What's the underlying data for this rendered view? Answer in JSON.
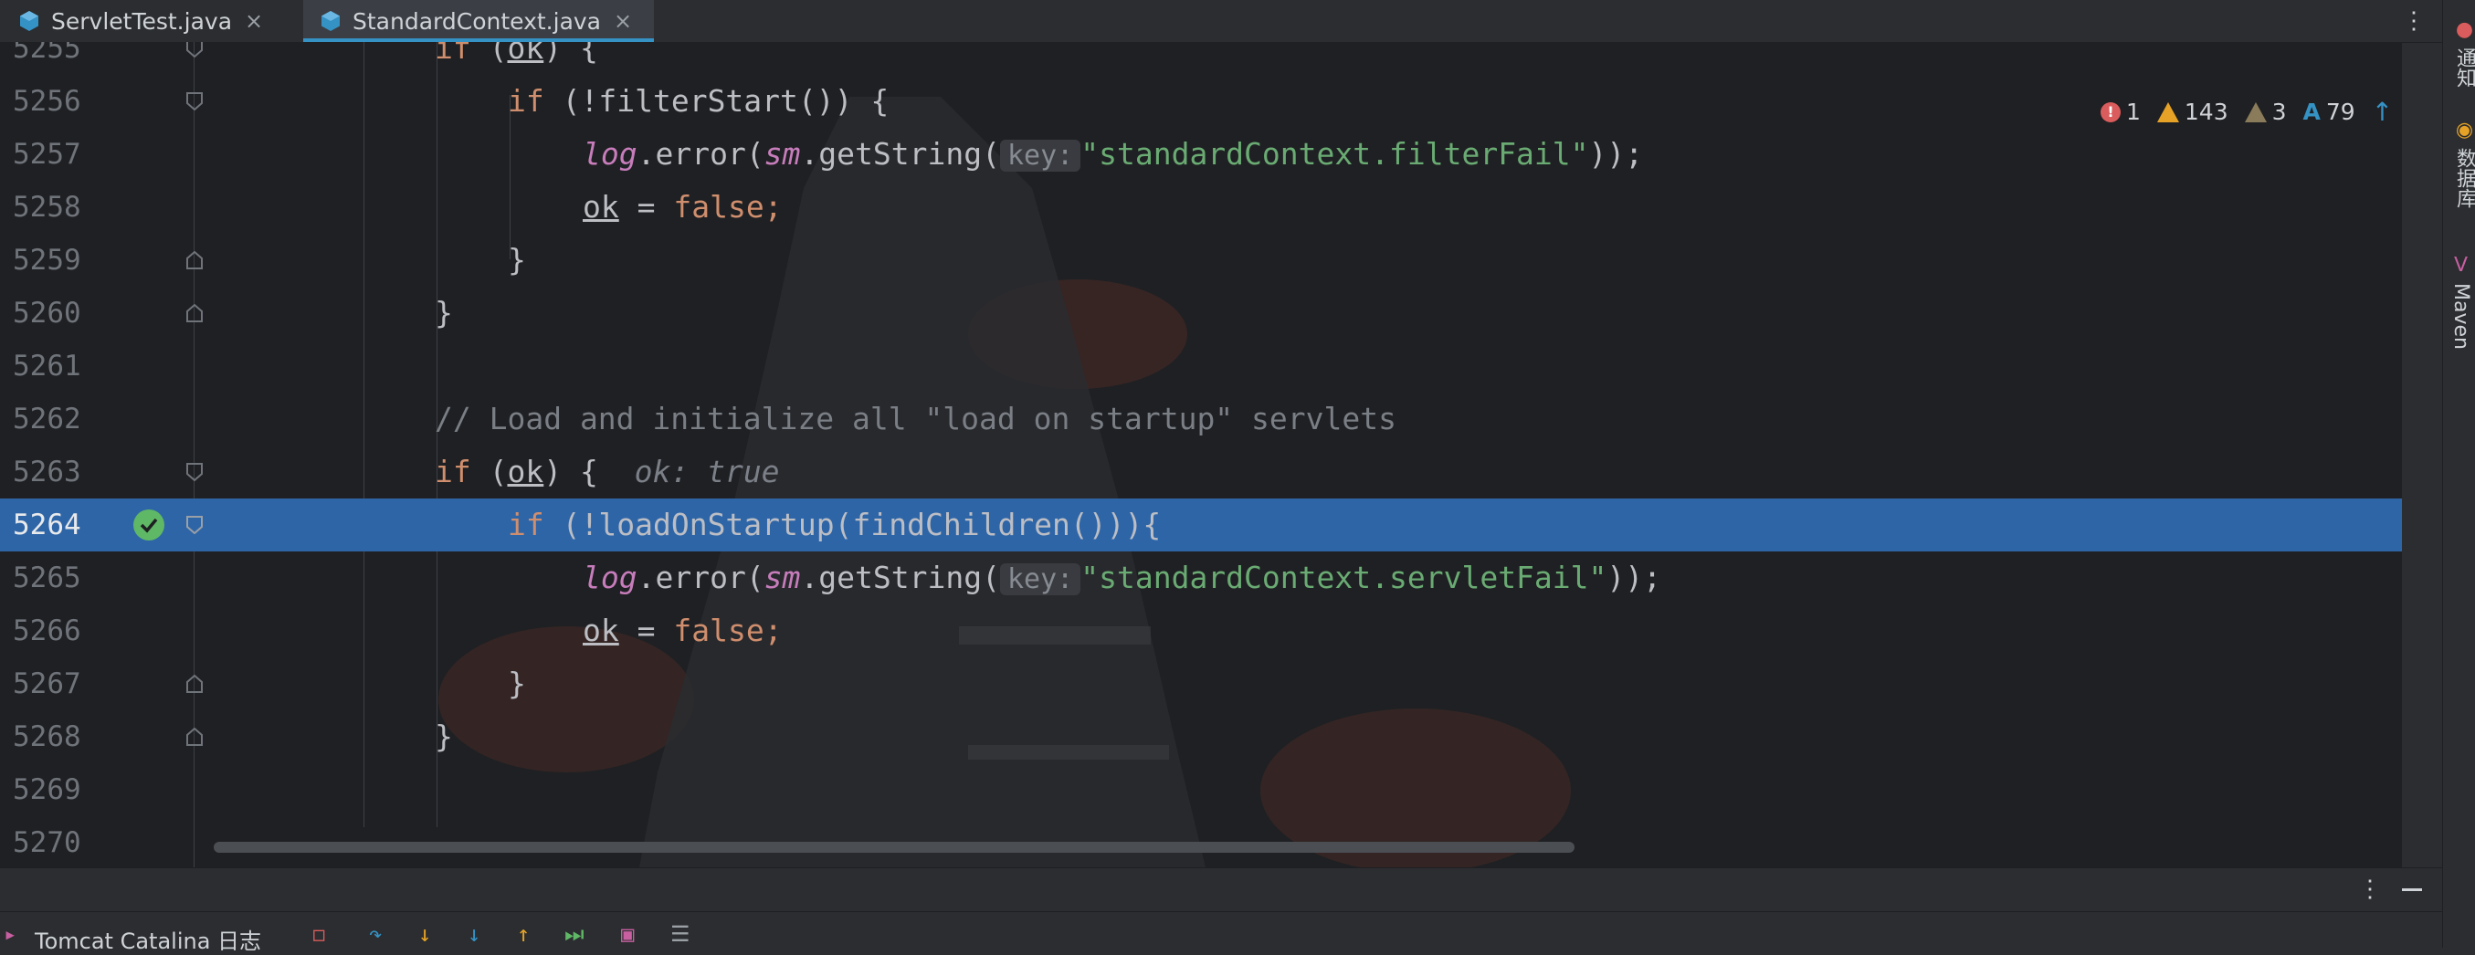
{
  "tabs": [
    {
      "label": "ServletTest.java",
      "close": "×",
      "active": false
    },
    {
      "label": "StandardContext.java",
      "close": "×",
      "active": true
    }
  ],
  "editor": {
    "menu_glyph": "⋮",
    "lines": [
      {
        "num": "5255"
      },
      {
        "num": "5256"
      },
      {
        "num": "5257"
      },
      {
        "num": "5258"
      },
      {
        "num": "5259"
      },
      {
        "num": "5260"
      },
      {
        "num": "5261"
      },
      {
        "num": "5262"
      },
      {
        "num": "5263"
      },
      {
        "num": "5264"
      },
      {
        "num": "5265"
      },
      {
        "num": "5266"
      },
      {
        "num": "5267"
      },
      {
        "num": "5268"
      },
      {
        "num": "5269"
      },
      {
        "num": "5270"
      }
    ],
    "tokens": {
      "kw_if": "if",
      "kw_false": "false",
      "ok": "ok",
      "filterStart": "(!filterStart()) {",
      "log": "log",
      "error_call": ".error(",
      "sm": "sm",
      "getString": ".getString(",
      "key_hint": "key:",
      "str_filter": "\"standardContext.filterFail\"",
      "str_servlet": "\"standardContext.servletFail\"",
      "close_paren": "));",
      "assign": " = ",
      "semi": ";",
      "rbrace": "}",
      "ok_open": " (",
      "ok_close": ") {",
      "comment": "// Load and initialize all \"load on startup\" servlets",
      "inline_value": "ok: true",
      "loadOnStartup": "(!loadOnStartup(findChildren())){"
    },
    "inspections": {
      "errors": "1",
      "warnings": "143",
      "weak_warnings": "3",
      "typos": "79",
      "error_glyph": "!",
      "typo_glyph": "A",
      "up_glyph": "↑",
      "down_glyph": "↓"
    },
    "highlight_color": "#2e65a7"
  },
  "right_strip": {
    "notifications": "通知",
    "database": "数据库",
    "maven": "Maven"
  },
  "bottom_panel": {
    "title": "Tomcat Catalina 日志",
    "menu_glyph": "⋮"
  },
  "colors": {
    "keyword": "#cf8e6d",
    "string": "#6aab73",
    "field": "#c77dbb",
    "comment": "#7a7e85",
    "accent": "#3592c4"
  }
}
